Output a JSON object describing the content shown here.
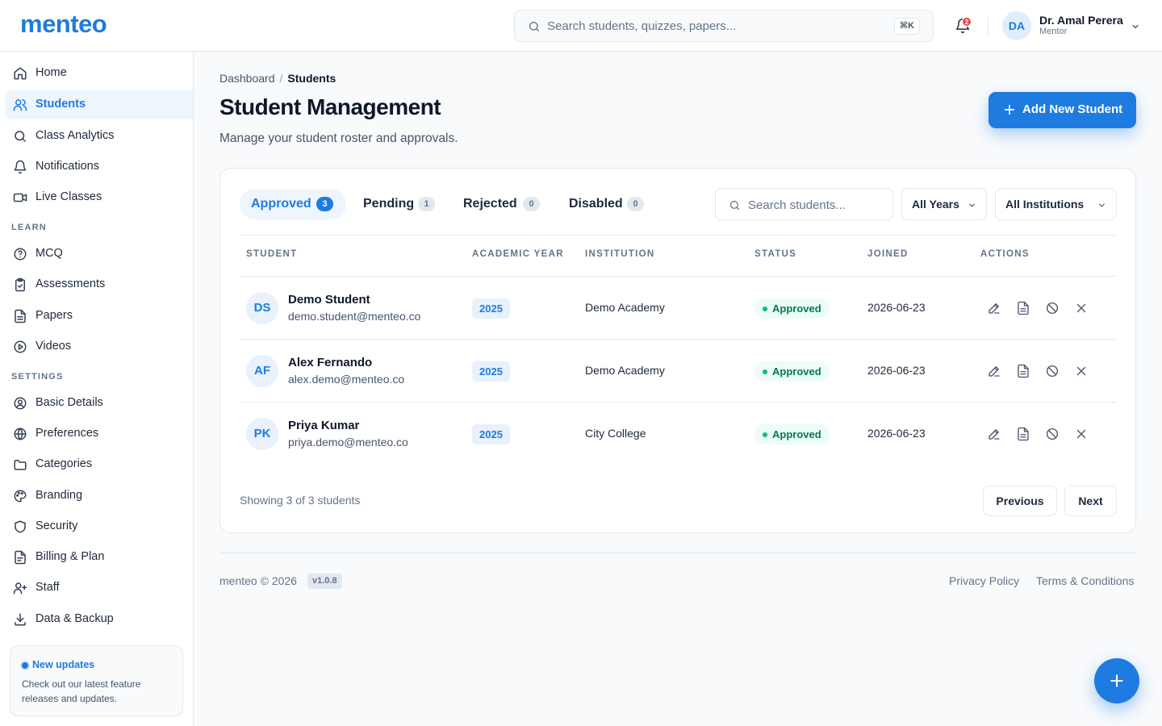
{
  "header": {
    "logo": "menteo",
    "search_placeholder": "Search students, quizzes, papers...",
    "shortcut": "⌘K",
    "notification_count": "2",
    "user": {
      "initials": "DA",
      "name": "Dr. Amal Perera",
      "role": "Mentor"
    }
  },
  "sidebar": {
    "main_items": [
      {
        "label": "Home",
        "icon": "home-icon"
      },
      {
        "label": "Students",
        "icon": "users-icon",
        "active": true
      },
      {
        "label": "Class Analytics",
        "icon": "search-icon"
      },
      {
        "label": "Notifications",
        "icon": "bell-icon"
      },
      {
        "label": "Live Classes",
        "icon": "video-icon"
      }
    ],
    "learn_label": "LEARN",
    "learn_items": [
      {
        "label": "MCQ",
        "icon": "help-circle-icon"
      },
      {
        "label": "Assessments",
        "icon": "clipboard-check-icon"
      },
      {
        "label": "Papers",
        "icon": "file-text-icon"
      },
      {
        "label": "Videos",
        "icon": "play-circle-icon"
      }
    ],
    "settings_label": "SETTINGS",
    "settings_items": [
      {
        "label": "Basic Details",
        "icon": "user-circle-icon"
      },
      {
        "label": "Preferences",
        "icon": "globe-icon"
      },
      {
        "label": "Categories",
        "icon": "folder-icon"
      },
      {
        "label": "Branding",
        "icon": "palette-icon"
      },
      {
        "label": "Security",
        "icon": "shield-icon"
      },
      {
        "label": "Billing & Plan",
        "icon": "receipt-icon"
      },
      {
        "label": "Staff",
        "icon": "user-plus-icon"
      },
      {
        "label": "Data & Backup",
        "icon": "download-icon"
      }
    ],
    "updates": {
      "title": "New updates",
      "text": "Check out our latest feature releases and updates."
    }
  },
  "main": {
    "breadcrumb": {
      "root": "Dashboard",
      "separator": "/",
      "current": "Students"
    },
    "title": "Student Management",
    "subtitle": "Manage your student roster and approvals.",
    "add_button": "Add New Student",
    "tabs": [
      {
        "label": "Approved",
        "count": "3",
        "active": true
      },
      {
        "label": "Pending",
        "count": "1"
      },
      {
        "label": "Rejected",
        "count": "0"
      },
      {
        "label": "Disabled",
        "count": "0"
      }
    ],
    "search_placeholder": "Search students...",
    "filters": {
      "year": "All Years",
      "institution": "All Institutions"
    },
    "columns": [
      "STUDENT",
      "ACADEMIC YEAR",
      "INSTITUTION",
      "STATUS",
      "JOINED",
      "ACTIONS"
    ],
    "rows": [
      {
        "initials": "DS",
        "name": "Demo Student",
        "email": "demo.student@menteo.co",
        "year": "2025",
        "institution": "Demo Academy",
        "status": "Approved",
        "joined": "2026-06-23"
      },
      {
        "initials": "AF",
        "name": "Alex Fernando",
        "email": "alex.demo@menteo.co",
        "year": "2025",
        "institution": "Demo Academy",
        "status": "Approved",
        "joined": "2026-06-23"
      },
      {
        "initials": "PK",
        "name": "Priya Kumar",
        "email": "priya.demo@menteo.co",
        "year": "2025",
        "institution": "City College",
        "status": "Approved",
        "joined": "2026-06-23"
      }
    ],
    "showing": "Showing 3 of 3 students",
    "pagination": {
      "previous": "Previous",
      "next": "Next"
    }
  },
  "footer": {
    "copyright": "menteo © 2026",
    "version": "v1.0.8",
    "privacy": "Privacy Policy",
    "terms": "Terms & Conditions"
  },
  "colors": {
    "accent": "#1e7be0",
    "status_approved_bg": "#ecfdf5",
    "status_approved_text": "#047857",
    "notification_badge": "#ef4444"
  }
}
